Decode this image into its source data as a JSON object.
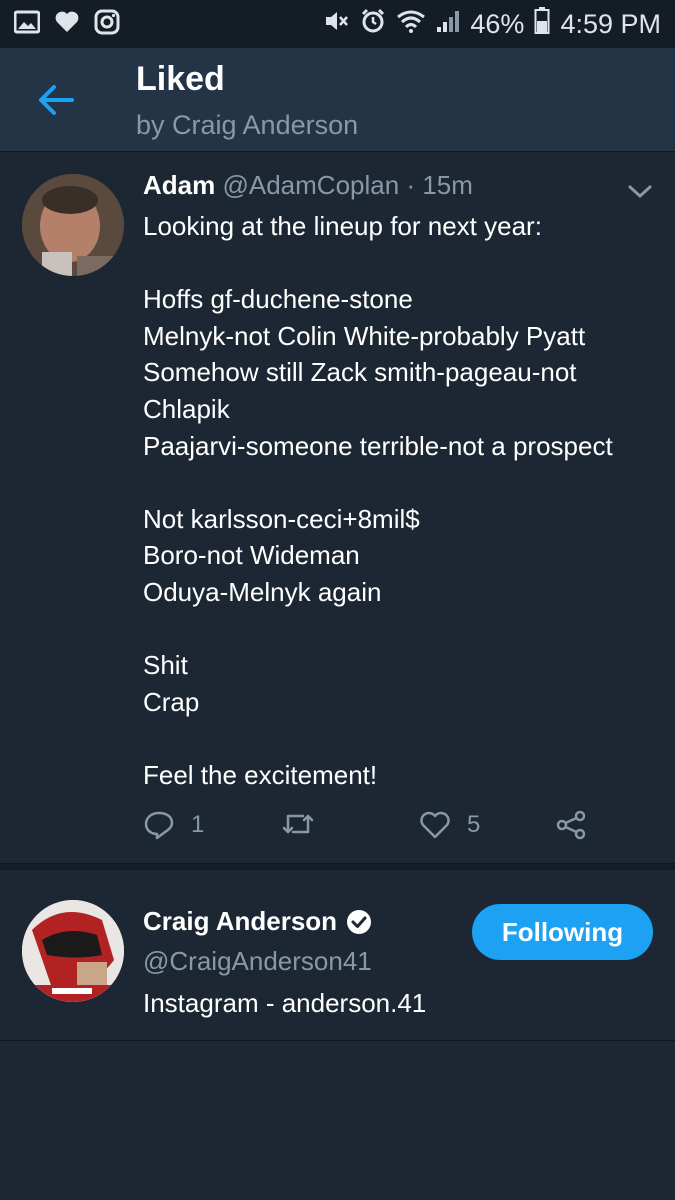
{
  "status_bar": {
    "battery_percent": "46%",
    "time": "4:59 PM",
    "left_icons": [
      "gallery-icon",
      "heart-icon",
      "instagram-icon"
    ],
    "right_icons": [
      "mute-icon",
      "alarm-icon",
      "wifi-icon",
      "signal-icon",
      "battery-icon"
    ]
  },
  "header": {
    "title": "Liked",
    "subtitle": "by Craig Anderson"
  },
  "tweet": {
    "name": "Adam",
    "handle": "@AdamCoplan",
    "separator": "·",
    "time": "15m",
    "lines": [
      "Looking at the lineup for next year:",
      "",
      "Hoffs gf-duchene-stone",
      "Melnyk-not Colin White-probably Pyatt",
      "Somehow still Zack smith-pageau-not",
      "Chlapik",
      "Paajarvi-someone terrible-not a prospect",
      "",
      "Not karlsson-ceci+8mil$",
      "Boro-not Wideman",
      "Oduya-Melnyk again",
      "",
      "Shit",
      "Crap",
      "",
      "Feel the excitement!"
    ],
    "reply_count": "1",
    "retweet_count": "",
    "like_count": "5"
  },
  "profile": {
    "name": "Craig Anderson",
    "handle": "@CraigAnderson41",
    "bio": "Instagram - anderson.41",
    "follow_label": "Following",
    "verified": true
  },
  "colors": {
    "background": "#1c2733",
    "header": "#243447",
    "status_bar": "#141d26",
    "accent": "#1da1f2",
    "secondary_text": "#8899a6"
  }
}
